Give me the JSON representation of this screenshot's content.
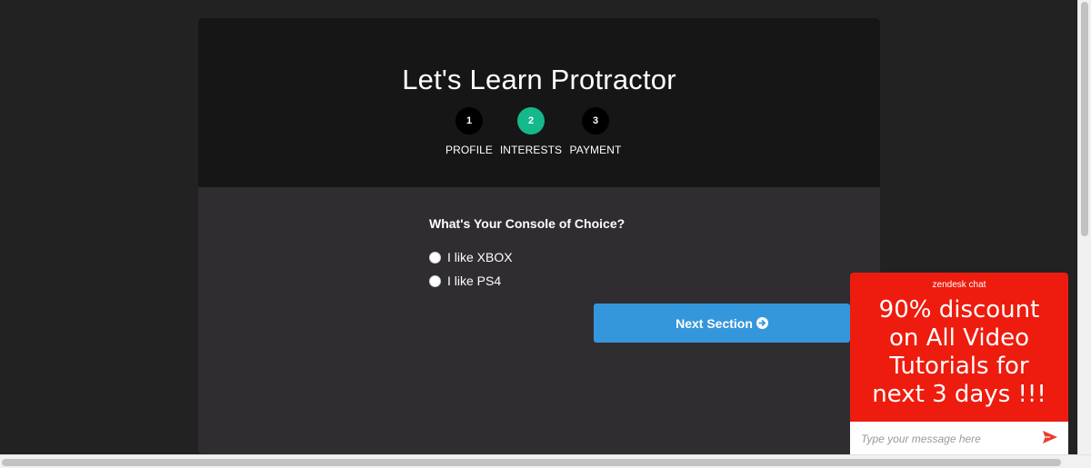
{
  "form": {
    "title": "Let's Learn Protractor",
    "steps": [
      {
        "number": "1",
        "label": "PROFILE",
        "active": false
      },
      {
        "number": "2",
        "label": "INTERESTS",
        "active": true
      },
      {
        "number": "3",
        "label": "PAYMENT",
        "active": false
      }
    ],
    "question": "What's Your Console of Choice?",
    "options": [
      {
        "label": "I like XBOX",
        "checked": false
      },
      {
        "label": "I like PS4",
        "checked": false
      }
    ],
    "next_button": "Next Section"
  },
  "chat": {
    "brand": "zendesk chat",
    "message_lines": [
      "90% discount",
      "on All Video",
      "Tutorials for",
      "next 3 days !!!"
    ],
    "input_placeholder": "Type your message here",
    "send_icon": "paper-plane-icon"
  },
  "colors": {
    "active_step": "#14b88a",
    "button": "#3597db",
    "chat_background": "#ee1c0e",
    "send_icon": "#ee3b2c"
  }
}
